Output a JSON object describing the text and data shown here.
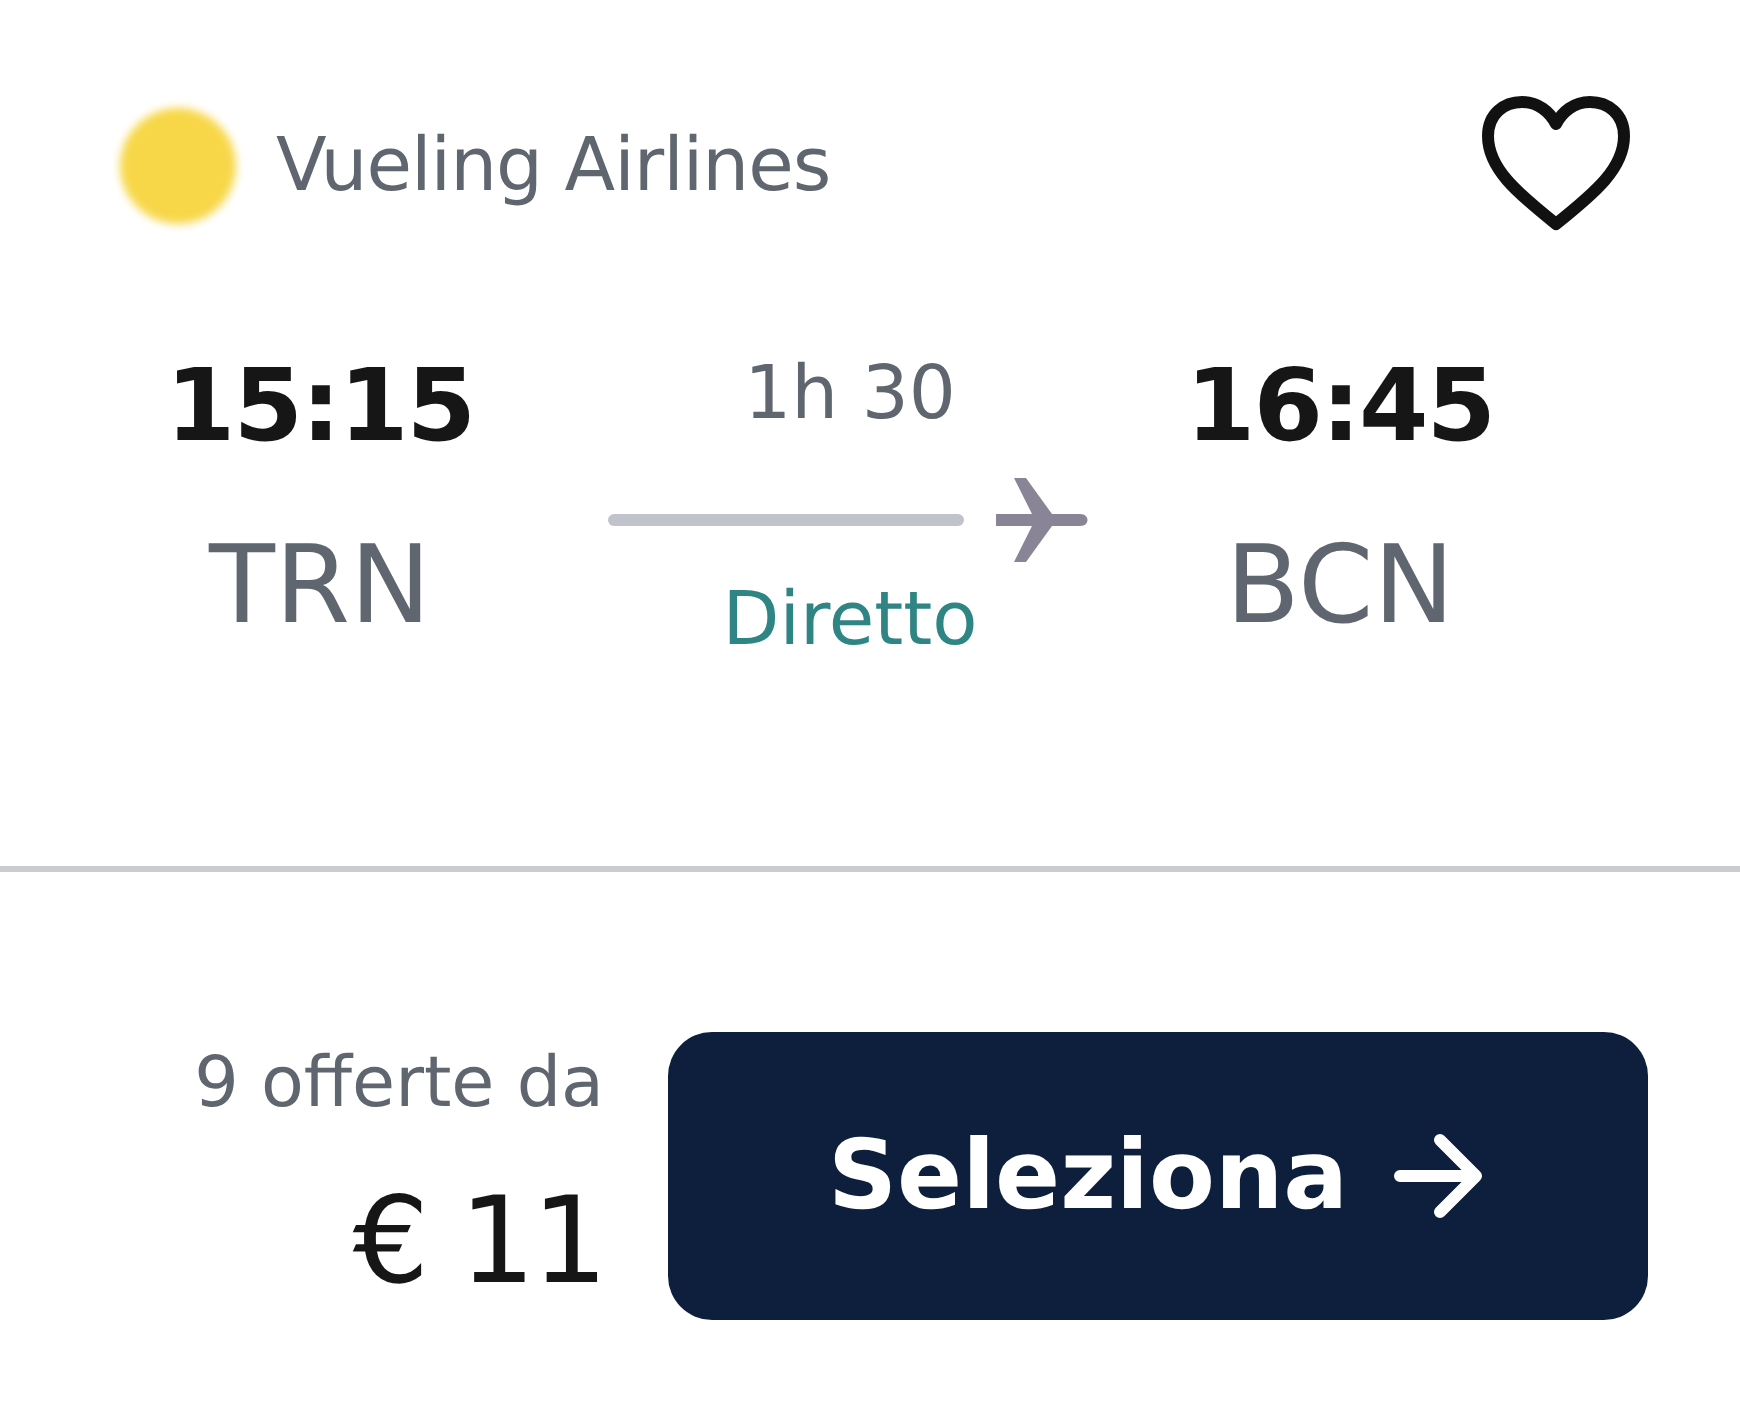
{
  "airline": {
    "name": "Vueling Airlines"
  },
  "saved": false,
  "departure": {
    "time": "15:15",
    "airport": "TRN"
  },
  "duration": "1h 30",
  "stops": "Diretto",
  "arrival": {
    "time": "16:45",
    "airport": "BCN"
  },
  "offers": "9 offerte da",
  "price": "€ 11",
  "button": "Seleziona"
}
